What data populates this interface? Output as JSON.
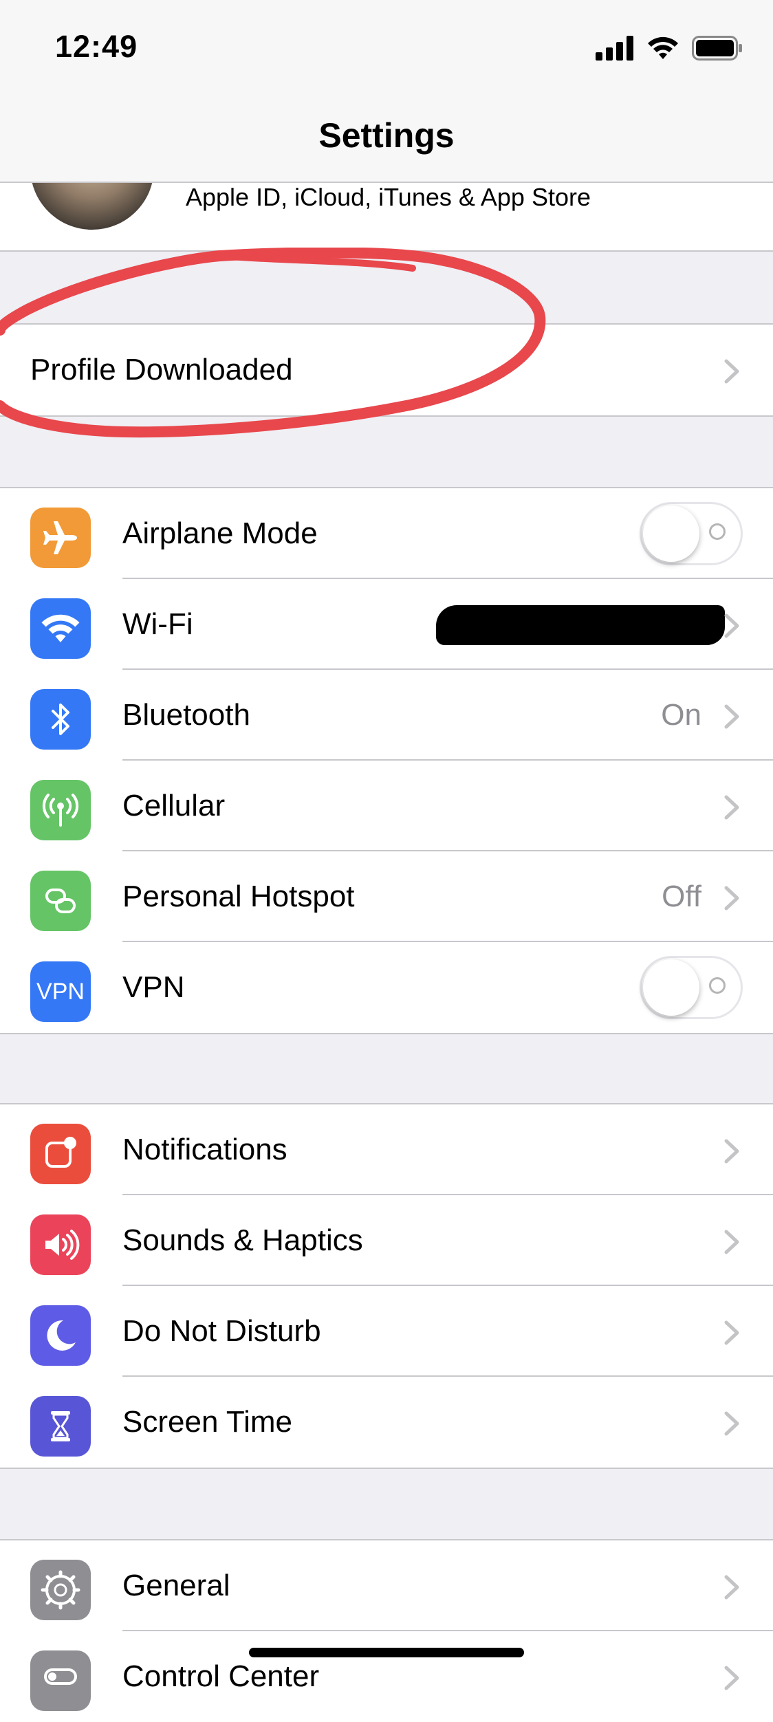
{
  "status_bar": {
    "time": "12:49"
  },
  "nav": {
    "title": "Settings"
  },
  "apple_id": {
    "subtitle": "Apple ID, iCloud, iTunes & App Store"
  },
  "profile": {
    "label": "Profile Downloaded"
  },
  "connectivity": [
    {
      "label": "Airplane Mode",
      "icon": "airplane-icon",
      "color": "#f19a37",
      "control": "toggle",
      "state": "off"
    },
    {
      "label": "Wi-Fi",
      "icon": "wifi-icon",
      "color": "#3478f6",
      "value": "",
      "control": "chevron"
    },
    {
      "label": "Bluetooth",
      "icon": "bluetooth-icon",
      "color": "#3478f6",
      "value": "On",
      "control": "chevron"
    },
    {
      "label": "Cellular",
      "icon": "cellular-icon",
      "color": "#65c466",
      "value": "",
      "control": "chevron"
    },
    {
      "label": "Personal Hotspot",
      "icon": "hotspot-icon",
      "color": "#65c466",
      "value": "Off",
      "control": "chevron"
    },
    {
      "label": "VPN",
      "icon": "vpn-icon",
      "icon_text": "VPN",
      "color": "#3478f6",
      "control": "toggle",
      "state": "off"
    }
  ],
  "alerts": [
    {
      "label": "Notifications",
      "icon": "notifications-icon",
      "color": "#eb4d3d"
    },
    {
      "label": "Sounds & Haptics",
      "icon": "sounds-icon",
      "color": "#eb445a"
    },
    {
      "label": "Do Not Disturb",
      "icon": "moon-icon",
      "color": "#5e5ce6"
    },
    {
      "label": "Screen Time",
      "icon": "hourglass-icon",
      "color": "#5856d6"
    }
  ],
  "system": [
    {
      "label": "General",
      "icon": "gear-icon",
      "color": "#8e8e93"
    },
    {
      "label": "Control Center",
      "icon": "control-center-icon",
      "color": "#8e8e93"
    }
  ],
  "colors": {
    "annotation": "#e8474c",
    "separator": "#c8c7cc",
    "background": "#efeff4"
  }
}
